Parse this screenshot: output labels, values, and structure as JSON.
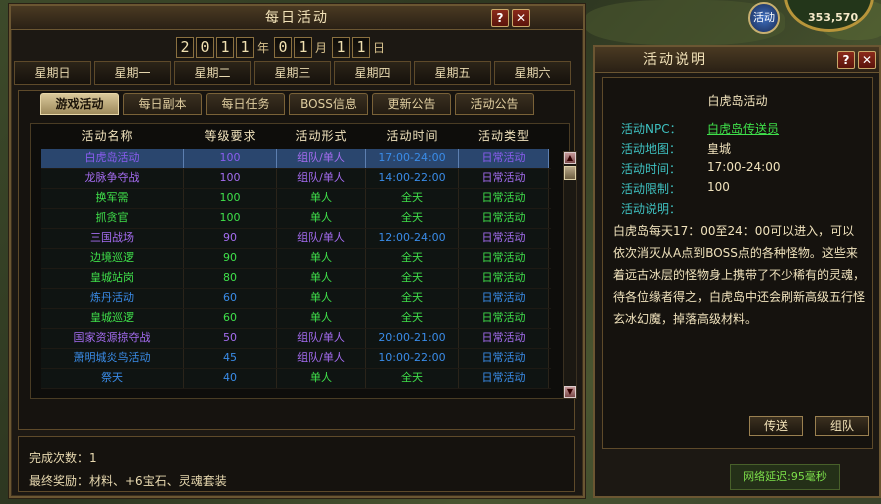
{
  "main_window": {
    "title": "每日活动",
    "help_label": "?",
    "close_label": "✕",
    "date": {
      "year_digits": [
        "2",
        "0",
        "1",
        "1"
      ],
      "year_unit": "年",
      "month_digits": [
        "0",
        "1"
      ],
      "month_unit": "月",
      "day_digits": [
        "1",
        "1"
      ],
      "day_unit": "日"
    },
    "weekdays": [
      "星期日",
      "星期一",
      "星期二",
      "星期三",
      "星期四",
      "星期五",
      "星期六"
    ],
    "tabs": [
      "游戏活动",
      "每日副本",
      "每日任务",
      "BOSS信息",
      "更新公告",
      "活动公告"
    ],
    "active_tab": 0,
    "table": {
      "headers": [
        "活动名称",
        "等级要求",
        "活动形式",
        "活动时间",
        "活动类型"
      ],
      "rows": [
        {
          "name": "白虎岛活动",
          "level": "100",
          "form": "组队/单人",
          "time": "17:00-24:00",
          "type": "日常活动",
          "color": "#8a5cf0",
          "selected": true
        },
        {
          "name": "龙脉争夺战",
          "level": "100",
          "form": "组队/单人",
          "time": "14:00-22:00",
          "type": "日常活动",
          "color": "#a46cf0",
          "selected": false
        },
        {
          "name": "换军需",
          "level": "100",
          "form": "单人",
          "time": "全天",
          "type": "日常活动",
          "color": "#3fe04a",
          "selected": false
        },
        {
          "name": "抓贪官",
          "level": "100",
          "form": "单人",
          "time": "全天",
          "type": "日常活动",
          "color": "#3fe04a",
          "selected": false
        },
        {
          "name": "三国战场",
          "level": "90",
          "form": "组队/单人",
          "time": "12:00-24:00",
          "type": "日常活动",
          "color": "#a46cf0",
          "selected": false
        },
        {
          "name": "边境巡逻",
          "level": "90",
          "form": "单人",
          "time": "全天",
          "type": "日常活动",
          "color": "#3fe04a",
          "selected": false
        },
        {
          "name": "皇城站岗",
          "level": "80",
          "form": "单人",
          "time": "全天",
          "type": "日常活动",
          "color": "#3fe04a",
          "selected": false
        },
        {
          "name": "炼丹活动",
          "level": "60",
          "form": "单人",
          "time": "全天",
          "type": "日常活动",
          "color": "#3a8ce8",
          "selected": false
        },
        {
          "name": "皇城巡逻",
          "level": "60",
          "form": "单人",
          "time": "全天",
          "type": "日常活动",
          "color": "#3fe04a",
          "selected": false
        },
        {
          "name": "国家资源掠夺战",
          "level": "50",
          "form": "组队/单人",
          "time": "20:00-21:00",
          "type": "日常活动",
          "color": "#a46cf0",
          "selected": false
        },
        {
          "name": "萧明城炎鸟活动",
          "level": "45",
          "form": "组队/单人",
          "time": "10:00-22:00",
          "type": "日常活动",
          "color": "#3a8ce8",
          "selected": false
        },
        {
          "name": "祭天",
          "level": "40",
          "form": "单人",
          "time": "全天",
          "type": "日常活动",
          "color": "#3a8ce8",
          "selected": false
        }
      ]
    },
    "completion": "完成次数：1",
    "reward": "最终奖励：材料、+6宝石、灵魂套装"
  },
  "side_window": {
    "title": "活动说明",
    "help_label": "?",
    "close_label": "✕",
    "heading": "白虎岛活动",
    "fields": [
      {
        "label": "活动NPC：",
        "value": "白虎岛传送员",
        "value_color": "#3fe04a",
        "underline": true
      },
      {
        "label": "活动地图：",
        "value": "皇城",
        "value_color": "#f0e2bc",
        "underline": false
      },
      {
        "label": "活动时间：",
        "value": "17:00-24:00",
        "value_color": "#f0e2bc",
        "underline": false
      },
      {
        "label": "活动限制：",
        "value": "100",
        "value_color": "#f0e2bc",
        "underline": false
      },
      {
        "label": "活动说明：",
        "value": "",
        "value_color": "#f0e2bc",
        "underline": false
      }
    ],
    "description": "白虎岛每天17：00至24：00可以进入，可以依次消灭从A点到BOSS点的各种怪物。这些来着远古冰层的怪物身上携带了不少稀有的灵魂，待各位缘者得之，白虎岛中还会刷新高级五行怪玄冰幻魔，掉落高级材料。",
    "teleport_button": "传送",
    "team_button": "组队",
    "latency": "网络延迟:95毫秒"
  },
  "status": {
    "coords": "353,570",
    "activity_icon_label": "活动"
  },
  "colors": {
    "header_blue": "#3ec0c0",
    "form_purple": "#a46cf0",
    "form_green": "#3fe04a",
    "type_green": "#3fe04a",
    "time_blue": "#3a8ce8",
    "level_green": "#3fe04a"
  }
}
